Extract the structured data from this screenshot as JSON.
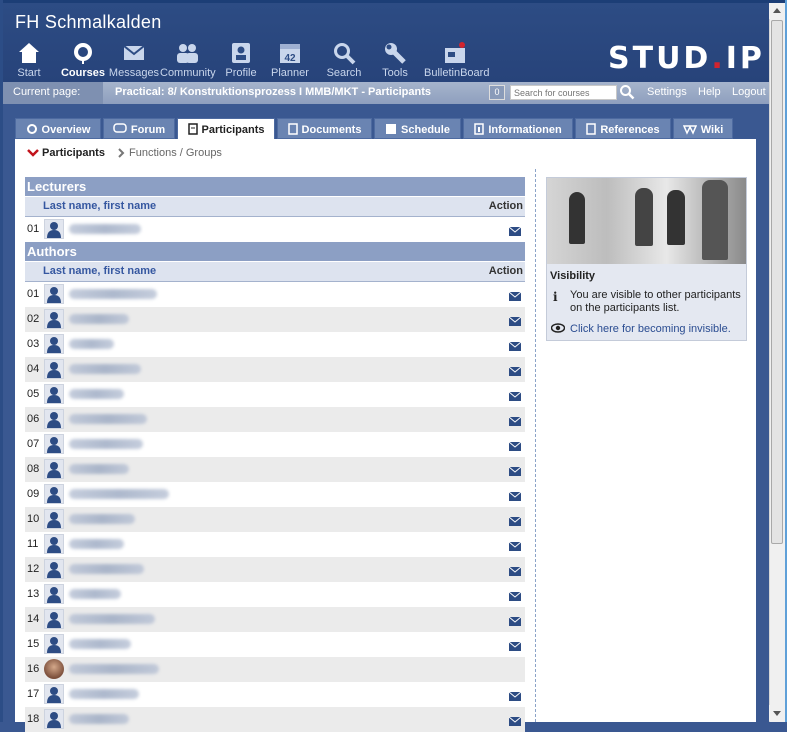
{
  "header": {
    "site_title": "FH Schmalkalden",
    "logo_text": "STUD",
    "logo_dot": ".",
    "logo_suffix": "IP",
    "nav": [
      {
        "label": "Start",
        "icon": "home-icon"
      },
      {
        "label": "Courses",
        "icon": "courses-icon",
        "active": true
      },
      {
        "label": "Messages",
        "icon": "envelope-icon"
      },
      {
        "label": "Community",
        "icon": "community-icon"
      },
      {
        "label": "Profile",
        "icon": "profile-icon"
      },
      {
        "label": "Planner",
        "icon": "calendar-icon",
        "badge": "42"
      },
      {
        "label": "Search",
        "icon": "search-icon"
      },
      {
        "label": "Tools",
        "icon": "wrench-icon"
      },
      {
        "label": "BulletinBoard",
        "icon": "bulletinboard-icon"
      }
    ]
  },
  "bar": {
    "current_page_label": "Current page:",
    "current_page_title": "Practical: 8/ Konstruktionsprozess I MMB/MKT - Participants",
    "counter": "0",
    "search_placeholder": "Search for courses",
    "links": [
      "Settings",
      "Help",
      "Logout"
    ]
  },
  "tabs": [
    {
      "label": "Overview",
      "icon": "overview-icon"
    },
    {
      "label": "Forum",
      "icon": "forum-icon"
    },
    {
      "label": "Participants",
      "icon": "participants-icon",
      "active": true
    },
    {
      "label": "Documents",
      "icon": "documents-icon"
    },
    {
      "label": "Schedule",
      "icon": "schedule-icon"
    },
    {
      "label": "Informationen",
      "icon": "info-icon"
    },
    {
      "label": "References",
      "icon": "references-icon"
    },
    {
      "label": "Wiki",
      "icon": "wiki-icon"
    }
  ],
  "subnav": {
    "active": "Participants",
    "inactive": "Functions / Groups"
  },
  "lecturers": {
    "title": "Lecturers",
    "col_name": "Last name, first name",
    "col_action": "Action",
    "rows": [
      {
        "num": "01",
        "mail": true
      }
    ]
  },
  "authors": {
    "title": "Authors",
    "col_name": "Last name, first name",
    "col_action": "Action",
    "rows": [
      {
        "num": "01",
        "mail": true
      },
      {
        "num": "02",
        "mail": true
      },
      {
        "num": "03",
        "mail": true
      },
      {
        "num": "04",
        "mail": true
      },
      {
        "num": "05",
        "mail": true
      },
      {
        "num": "06",
        "mail": true
      },
      {
        "num": "07",
        "mail": true
      },
      {
        "num": "08",
        "mail": true
      },
      {
        "num": "09",
        "mail": true
      },
      {
        "num": "10",
        "mail": true
      },
      {
        "num": "11",
        "mail": true
      },
      {
        "num": "12",
        "mail": true
      },
      {
        "num": "13",
        "mail": true
      },
      {
        "num": "14",
        "mail": true
      },
      {
        "num": "15",
        "mail": true
      },
      {
        "num": "16",
        "mail": false,
        "photo": true
      },
      {
        "num": "17",
        "mail": true
      },
      {
        "num": "18",
        "mail": true
      }
    ]
  },
  "sidebar": {
    "visibility_title": "Visibility",
    "visibility_text": "You are visible to other participants on the participants list.",
    "visibility_link": "Click here for becoming invisible."
  },
  "colors": {
    "header": "#2d4c84",
    "accent": "#d1242f",
    "section_header": "#8c9fc4",
    "link": "#2a4c91"
  }
}
